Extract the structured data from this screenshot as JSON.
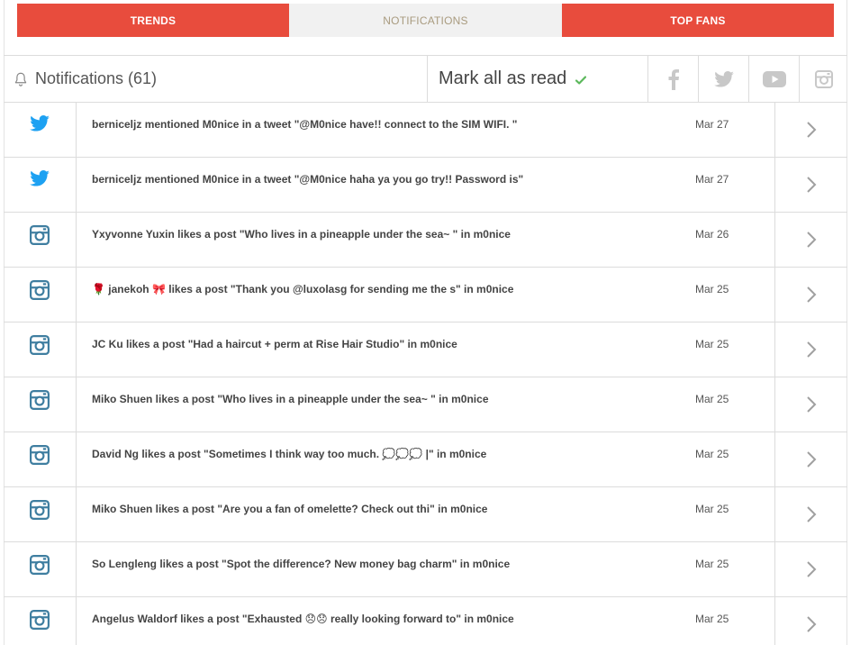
{
  "tabs": [
    {
      "label": "TRENDS",
      "style": "red"
    },
    {
      "label": "NOTIFICATIONS",
      "style": "active"
    },
    {
      "label": "TOP FANS",
      "style": "red"
    }
  ],
  "header": {
    "title": "Notifications (61)",
    "mark_all": "Mark all as read",
    "social": [
      "facebook-icon",
      "twitter-icon",
      "youtube-icon",
      "instagram-icon"
    ]
  },
  "colors": {
    "accent": "#e84c3d",
    "twitter": "#1da1f2",
    "instagram": "#3f7ea0",
    "check": "#5cb85c",
    "social_gray": "#c8c8c8"
  },
  "notifications": [
    {
      "source": "twitter",
      "text": "berniceljz mentioned M0nice in a tweet \"@M0nice have!! connect to the SIM WIFI. \"",
      "date": "Mar 27"
    },
    {
      "source": "twitter",
      "text": "berniceljz mentioned M0nice in a tweet \"@M0nice haha ya you go try!! Password is\"",
      "date": "Mar 27"
    },
    {
      "source": "instagram",
      "text": "Yxyvonne Yuxin likes a post \"Who lives in a pineapple under the sea~ \" in m0nice",
      "date": "Mar 26"
    },
    {
      "source": "instagram",
      "text": "🌹 janekoh 🎀 likes a post \"Thank you @luxolasg for sending me the s\" in m0nice",
      "date": "Mar 25"
    },
    {
      "source": "instagram",
      "text": "JC Ku likes a post \"Had a haircut + perm at Rise Hair Studio\" in m0nice",
      "date": "Mar 25"
    },
    {
      "source": "instagram",
      "text": "Miko Shuen likes a post \"Who lives in a pineapple under the sea~ \" in m0nice",
      "date": "Mar 25"
    },
    {
      "source": "instagram",
      "text": "David Ng likes a post \"Sometimes I think way too much. 💭💭💭 |\" in m0nice",
      "date": "Mar 25"
    },
    {
      "source": "instagram",
      "text": "Miko Shuen likes a post \"Are you a fan of omelette? Check out thi\" in m0nice",
      "date": "Mar 25"
    },
    {
      "source": "instagram",
      "text": "So Lengleng likes a post \"Spot the difference? New money bag charm\" in m0nice",
      "date": "Mar 25"
    },
    {
      "source": "instagram",
      "text": "Angelus Waldorf likes a post \"Exhausted 😞😞 really looking forward to\" in m0nice",
      "date": "Mar 25"
    }
  ]
}
